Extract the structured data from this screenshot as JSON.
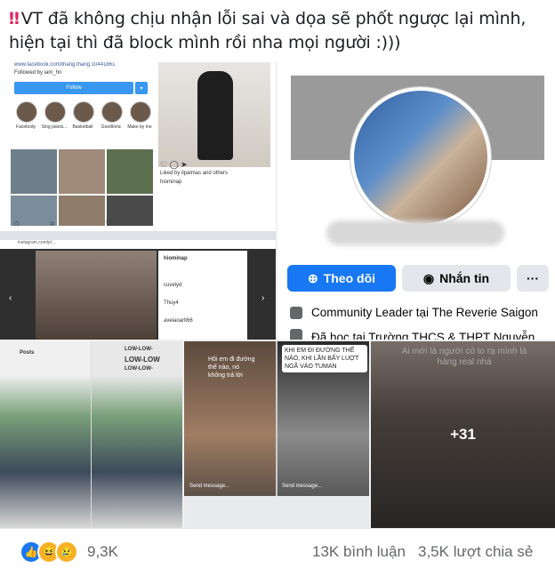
{
  "post": {
    "caption_icon": "double-exclamation",
    "caption": "VT đã không chịu nhận lỗi sai và dọa sẽ phốt ngược lại mình, hiện tại thì đã block mình rồi nha mọi người :)))"
  },
  "tile_insta": {
    "profile_link": "www.facebook.com/thang.thang.10441861",
    "followed_by": "Followed by iam_hn",
    "follow_label": "Follow",
    "highlights": [
      "Facebody",
      "Sing pianis...",
      "Basketball",
      "Goodlonic",
      "Make by me"
    ],
    "liked_by": "Liked by ilpalmas and others",
    "username": "hiominap",
    "comment_user_1": "cuvelyd",
    "comment_user_2": "Thuy4",
    "comment_user_3": "aveiaoarlt66"
  },
  "tile_fb_profile": {
    "follow_label": "Theo dõi",
    "message_label": "Nhắn tin",
    "more_label": "···",
    "info_1": "Community Leader tại The Reverie Saigon",
    "info_2": "Đã học tại Trường THCS & THPT Nguyễn Tất"
  },
  "tile_chat": {
    "header": "Posts",
    "chat_1": "LOW-LOW-",
    "chat_2": "LOW-LOW",
    "chat_3": "LOW-LOW-"
  },
  "tile_story": {
    "sticker_1": "Hôi em đi đường thế nào, nó không trả lời",
    "sticker_2": "KHI EM ĐI ĐƯỜNG THẾ NÀO, KHI LẦN BẤY LUỢT NGÃ VÀO TUMAN",
    "send_placeholder": "Send message...",
    "send_placeholder_2": "Send message..."
  },
  "tile_more": {
    "overlay_text": "Ai mới là người có to rạ mình là hàng real nhá",
    "more_count": "+31"
  },
  "footer": {
    "reaction_count": "9,3K",
    "comments": "13K bình luận",
    "shares": "3,5K lượt chia sẻ"
  },
  "colors": {
    "fb_blue": "#1877f2",
    "caption_bang": "#e0245e",
    "meta_gray": "#65676b"
  }
}
